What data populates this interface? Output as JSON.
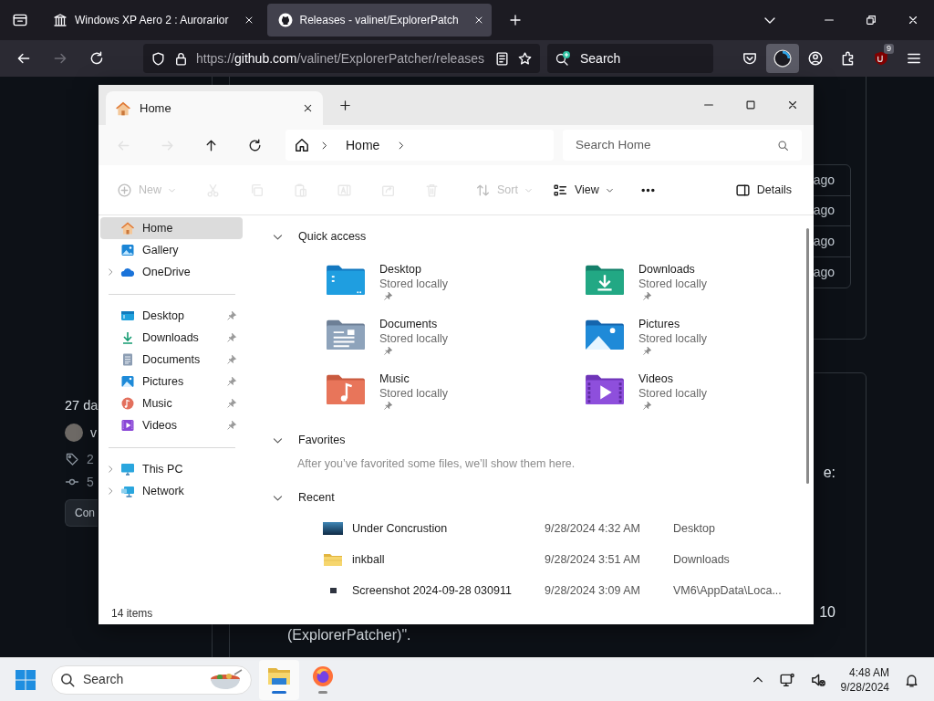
{
  "browser": {
    "tabs": [
      {
        "title": "Windows XP Aero 2 : Aurorarior",
        "kind": "columns",
        "selected": false
      },
      {
        "title": "Releases - valinet/ExplorerPatch",
        "kind": "github",
        "selected": true
      }
    ],
    "nav": [
      {
        "kind": "back",
        "disabled": false
      },
      {
        "kind": "forward",
        "disabled": true
      },
      {
        "kind": "reload",
        "disabled": false
      }
    ],
    "url": {
      "scheme": "https://",
      "host": "github.com",
      "path": "/valinet/ExplorerPatcher/releases"
    },
    "search": {
      "placeholder": "Search"
    },
    "toolbar": [
      {
        "kind": "pocket",
        "selected": false
      },
      {
        "kind": "addon",
        "selected": true
      },
      {
        "kind": "account",
        "selected": false
      },
      {
        "kind": "extensions",
        "selected": false
      },
      {
        "kind": "ublock",
        "selected": false,
        "badge": "9"
      },
      {
        "kind": "menu",
        "selected": false
      }
    ]
  },
  "page": {
    "side": {
      "date": "27 da",
      "author": "v",
      "tag": "2",
      "commits": "5",
      "button": "Con"
    },
    "release_rows": [
      "ago",
      "ago",
      "ago",
      "ago"
    ],
    "fragments": [
      "e:",
      "10"
    ],
    "closing": "(ExplorerPatcher)\"."
  },
  "explorer": {
    "tab": {
      "title": "Home"
    },
    "nav": [
      {
        "kind": "back",
        "disabled": true
      },
      {
        "kind": "forward",
        "disabled": true
      },
      {
        "kind": "up",
        "disabled": false
      },
      {
        "kind": "refresh",
        "disabled": false
      }
    ],
    "breadcrumbs": [
      "Home"
    ],
    "search": {
      "placeholder": "Search Home"
    },
    "commands": [
      {
        "kind": "new",
        "label": "New",
        "disabled": true
      },
      {
        "kind": "cut",
        "disabled": true
      },
      {
        "kind": "copy",
        "disabled": true
      },
      {
        "kind": "paste",
        "disabled": true
      },
      {
        "kind": "rename",
        "disabled": true
      },
      {
        "kind": "share",
        "disabled": true
      },
      {
        "kind": "delete",
        "disabled": true
      },
      {
        "kind": "sort",
        "label": "Sort",
        "disabled": true
      },
      {
        "kind": "view",
        "label": "View",
        "disabled": false
      },
      {
        "kind": "more",
        "disabled": false
      }
    ],
    "details": {
      "label": "Details"
    },
    "sidebar": [
      [
        {
          "label": "Home",
          "kind": "home",
          "selected": true,
          "expandable": false,
          "pinned": false
        },
        {
          "label": "Gallery",
          "kind": "gallery",
          "selected": false,
          "expandable": false,
          "pinned": false
        },
        {
          "label": "OneDrive",
          "kind": "onedrive",
          "selected": false,
          "expandable": true,
          "pinned": false
        }
      ],
      [
        {
          "label": "Desktop",
          "kind": "desktop",
          "selected": false,
          "expandable": false,
          "pinned": true
        },
        {
          "label": "Downloads",
          "kind": "downloads",
          "selected": false,
          "expandable": false,
          "pinned": true
        },
        {
          "label": "Documents",
          "kind": "documents",
          "selected": false,
          "expandable": false,
          "pinned": true
        },
        {
          "label": "Pictures",
          "kind": "pictures",
          "selected": false,
          "expandable": false,
          "pinned": true
        },
        {
          "label": "Music",
          "kind": "music",
          "selected": false,
          "expandable": false,
          "pinned": true
        },
        {
          "label": "Videos",
          "kind": "videos",
          "selected": false,
          "expandable": false,
          "pinned": true
        }
      ],
      [
        {
          "label": "This PC",
          "kind": "thispc",
          "selected": false,
          "expandable": true,
          "pinned": false
        },
        {
          "label": "Network",
          "kind": "network",
          "selected": false,
          "expandable": true,
          "pinned": false
        }
      ]
    ],
    "sections": [
      {
        "kind": "tiles",
        "title": "Quick access",
        "expanded": true,
        "items": [
          {
            "name": "Desktop",
            "status": "Stored locally",
            "kind": "desktop",
            "pinned": true
          },
          {
            "name": "Downloads",
            "status": "Stored locally",
            "kind": "downloads",
            "pinned": true
          },
          {
            "name": "Documents",
            "status": "Stored locally",
            "kind": "documents",
            "pinned": true
          },
          {
            "name": "Pictures",
            "status": "Stored locally",
            "kind": "pictures",
            "pinned": true
          },
          {
            "name": "Music",
            "status": "Stored locally",
            "kind": "music",
            "pinned": true
          },
          {
            "name": "Videos",
            "status": "Stored locally",
            "kind": "videos",
            "pinned": true
          }
        ]
      },
      {
        "kind": "empty",
        "title": "Favorites",
        "expanded": true,
        "text": "After you’ve favorited some files, we’ll show them here."
      },
      {
        "kind": "list",
        "title": "Recent",
        "expanded": true,
        "items": [
          {
            "name": "Under Concrustion",
            "date": "9/28/2024 4:32 AM",
            "location": "Desktop",
            "kind": "image"
          },
          {
            "name": "inkball",
            "date": "9/28/2024 3:51 AM",
            "location": "Downloads",
            "kind": "folder"
          },
          {
            "name": "Screenshot 2024-09-28 030911",
            "date": "9/28/2024 3:09 AM",
            "location": "VM6\\AppData\\Loca...",
            "kind": "screenshot"
          }
        ]
      }
    ],
    "status": "14 items"
  },
  "taskbar": {
    "search": {
      "placeholder": "Search"
    },
    "apps": [
      {
        "kind": "explorer",
        "active": true
      },
      {
        "kind": "firefox",
        "active": false
      }
    ],
    "time": "4:48 AM",
    "date": "9/28/2024"
  }
}
